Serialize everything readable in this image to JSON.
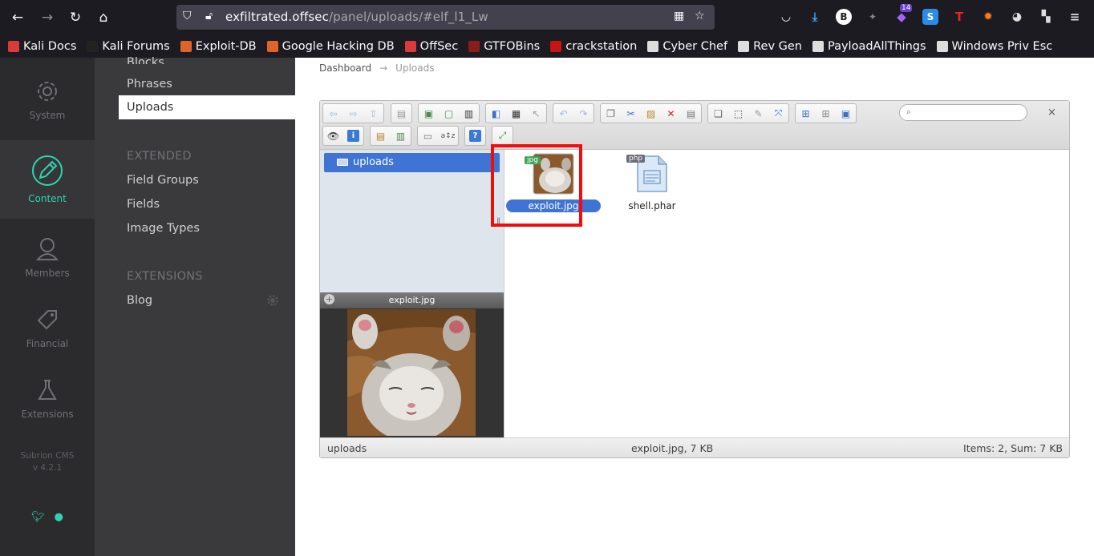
{
  "browser": {
    "url_host": "exfiltrated.offsec",
    "url_path": "/panel/uploads/#elf_l1_Lw",
    "badge_count": "14",
    "bookmarks": [
      {
        "label": "Kali Docs",
        "color": "#d93a3a"
      },
      {
        "label": "Kali Forums",
        "color": "#222"
      },
      {
        "label": "Exploit-DB",
        "color": "#e0642a"
      },
      {
        "label": "Google Hacking DB",
        "color": "#e0642a"
      },
      {
        "label": "OffSec",
        "color": "#d93a3a"
      },
      {
        "label": "GTFOBins",
        "color": "#8a1c1c"
      },
      {
        "label": "crackstation",
        "color": "#c71414"
      },
      {
        "label": "Cyber Chef",
        "color": "#ddd"
      },
      {
        "label": "Rev Gen",
        "color": "#ddd"
      },
      {
        "label": "PayloadAllThings",
        "color": "#ddd"
      },
      {
        "label": "Windows Priv Esc",
        "color": "#ddd"
      }
    ]
  },
  "sidebar": {
    "items": [
      {
        "label": "System",
        "icon": "gear-icon"
      },
      {
        "label": "Content",
        "icon": "pencil-icon",
        "active": true
      },
      {
        "label": "Members",
        "icon": "user-icon"
      },
      {
        "label": "Financial",
        "icon": "tag-icon"
      },
      {
        "label": "Extensions",
        "icon": "flask-icon"
      }
    ],
    "version_line1": "Subrion CMS",
    "version_line2": "v 4.2.1",
    "accent": "#2ed4b0"
  },
  "subnav": {
    "link_blocks": "Blocks",
    "link_phrases": "Phrases",
    "link_uploads": "Uploads",
    "head_extended": "EXTENDED",
    "link_field_groups": "Field Groups",
    "link_fields": "Fields",
    "link_image_types": "Image Types",
    "head_extensions": "EXTENSIONS",
    "link_blog": "Blog"
  },
  "breadcrumb": {
    "home": "Dashboard",
    "arrow": "→",
    "current": "Uploads"
  },
  "elfinder": {
    "search_icon": "⌕",
    "close_label": "×",
    "tree_root": "uploads",
    "preview_title": "exploit.jpg",
    "files": [
      {
        "name": "exploit.jpg",
        "badge": "jpg",
        "selected": true
      },
      {
        "name": "shell.phar",
        "badge": "php",
        "selected": false
      }
    ],
    "status_left": "uploads",
    "status_center": "exploit.jpg, 7 KB",
    "status_right": "Items: 2, Sum: 7 KB"
  }
}
